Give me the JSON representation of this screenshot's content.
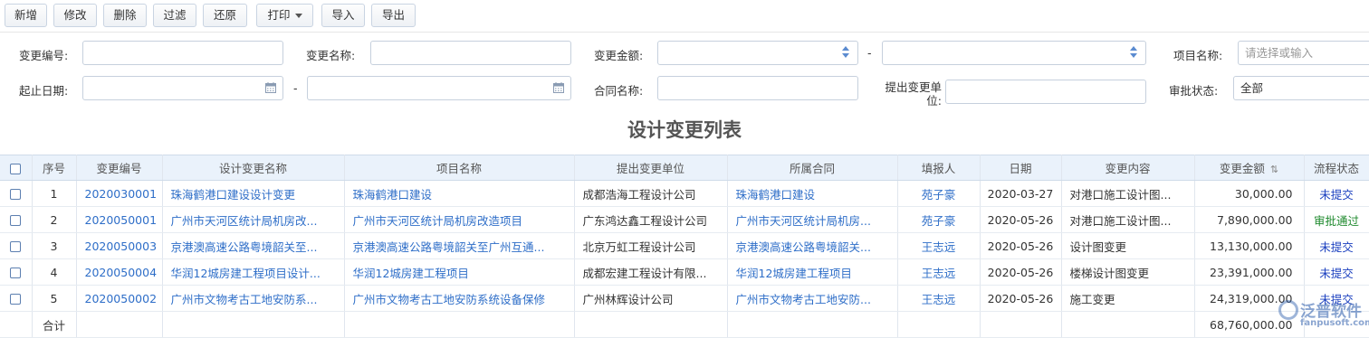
{
  "toolbar": {
    "add": "新增",
    "edit": "修改",
    "delete": "删除",
    "filter": "过滤",
    "restore": "还原",
    "print": "打印",
    "import": "导入",
    "export": "导出"
  },
  "filters": {
    "change_no_label": "变更编号:",
    "change_name_label": "变更名称:",
    "change_amount_label": "变更金额:",
    "range_sep": "-",
    "project_name_label": "项目名称:",
    "project_name_placeholder": "请选择或输入",
    "date_range_label": "起止日期:",
    "contract_name_label": "合同名称:",
    "unit_label": "提出变更单位:",
    "approval_label": "审批状态:",
    "approval_value": "全部"
  },
  "table": {
    "title": "设计变更列表",
    "headers": [
      "序号",
      "变更编号",
      "设计变更名称",
      "项目名称",
      "提出变更单位",
      "所属合同",
      "填报人",
      "日期",
      "变更内容",
      "变更金额",
      "流程状态"
    ],
    "rows": [
      {
        "no": "1",
        "code": "2020030001",
        "name": "珠海鹤港口建设设计变更",
        "project": "珠海鹤港口建设",
        "unit": "成都浩海工程设计公司",
        "contract": "珠海鹤港口建设",
        "reporter": "苑子豪",
        "date": "2020-03-27",
        "content": "对港口施工设计图...",
        "amount": "30,000.00",
        "status": "未提交"
      },
      {
        "no": "2",
        "code": "2020050001",
        "name": "广州市天河区统计局机房改...",
        "project": "广州市天河区统计局机房改造项目",
        "unit": "广东鸿达鑫工程设计公司",
        "contract": "广州市天河区统计局机房...",
        "reporter": "苑子豪",
        "date": "2020-05-26",
        "content": "对港口施工设计图...",
        "amount": "7,890,000.00",
        "status": "审批通过"
      },
      {
        "no": "3",
        "code": "2020050003",
        "name": "京港澳高速公路粤境韶关至...",
        "project": "京港澳高速公路粤境韶关至广州互通...",
        "unit": "北京万虹工程设计公司",
        "contract": "京港澳高速公路粤境韶关...",
        "reporter": "王志远",
        "date": "2020-05-26",
        "content": "设计图变更",
        "amount": "13,130,000.00",
        "status": "未提交"
      },
      {
        "no": "4",
        "code": "2020050004",
        "name": "华润12城房建工程项目设计...",
        "project": "华润12城房建工程项目",
        "unit": "成都宏建工程设计有限...",
        "contract": "华润12城房建工程项目",
        "reporter": "王志远",
        "date": "2020-05-26",
        "content": "楼梯设计图变更",
        "amount": "23,391,000.00",
        "status": "未提交"
      },
      {
        "no": "5",
        "code": "2020050002",
        "name": "广州市文物考古工地安防系...",
        "project": "广州市文物考古工地安防系统设备保修",
        "unit": "广州林辉设计公司",
        "contract": "广州市文物考古工地安防...",
        "reporter": "王志远",
        "date": "2020-05-26",
        "content": "施工变更",
        "amount": "24,319,000.00",
        "status": "未提交"
      }
    ],
    "total_label": "合计",
    "total_amount": "68,760,000.00"
  },
  "watermark": {
    "text": "泛普软件",
    "url": "fanpusoft.com"
  },
  "colors": {
    "link": "#2e6ec8",
    "header_bg": "#eaf2fb",
    "status_pending": "#1a3fbf",
    "status_approved": "#1f8a2e"
  }
}
